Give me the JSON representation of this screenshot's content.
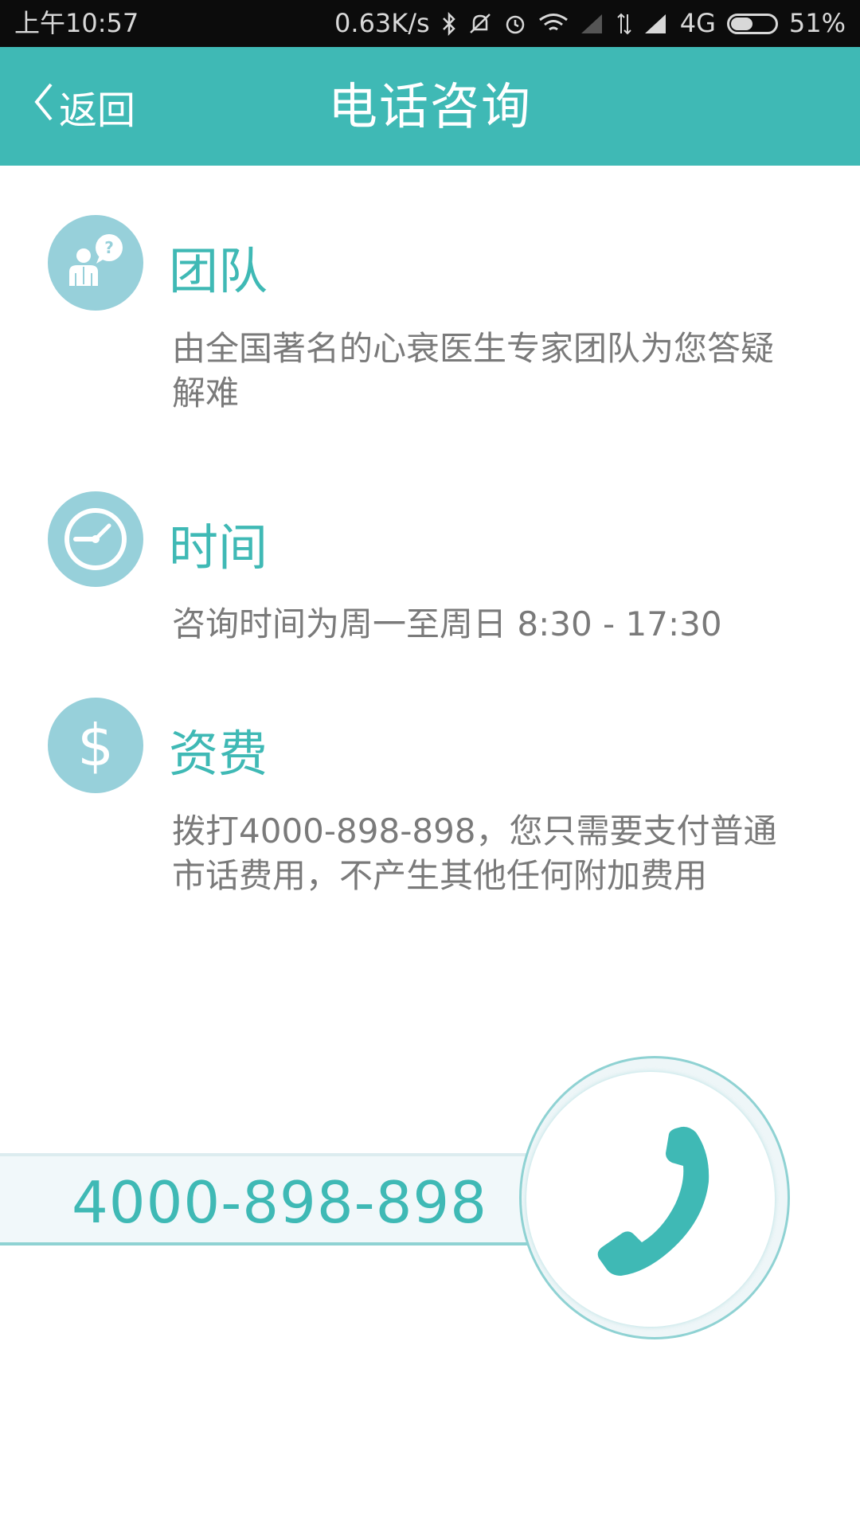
{
  "status_bar": {
    "time": "上午10:57",
    "network_speed": "0.63K/s",
    "network_type": "4G",
    "battery": "51%",
    "battery_level": 0.51
  },
  "header": {
    "back_label": "返回",
    "title": "电话咨询",
    "background_color": "#3fb9b5"
  },
  "sections": [
    {
      "icon": "doctor-question-icon",
      "title": "团队",
      "desc": "由全国著名的心衰医生专家团队为您答疑解难"
    },
    {
      "icon": "clock-icon",
      "title": "时间",
      "desc": "咨询时间为周一至周日  8:30 - 17:30"
    },
    {
      "icon": "dollar-icon",
      "title": "资费",
      "desc": "拨打4000-898-898，您只需要支付普通市话费用，不产生其他任何附加费用"
    }
  ],
  "call": {
    "number": "4000-898-898",
    "icon": "phone-icon",
    "accent_color": "#3fb9b5"
  }
}
